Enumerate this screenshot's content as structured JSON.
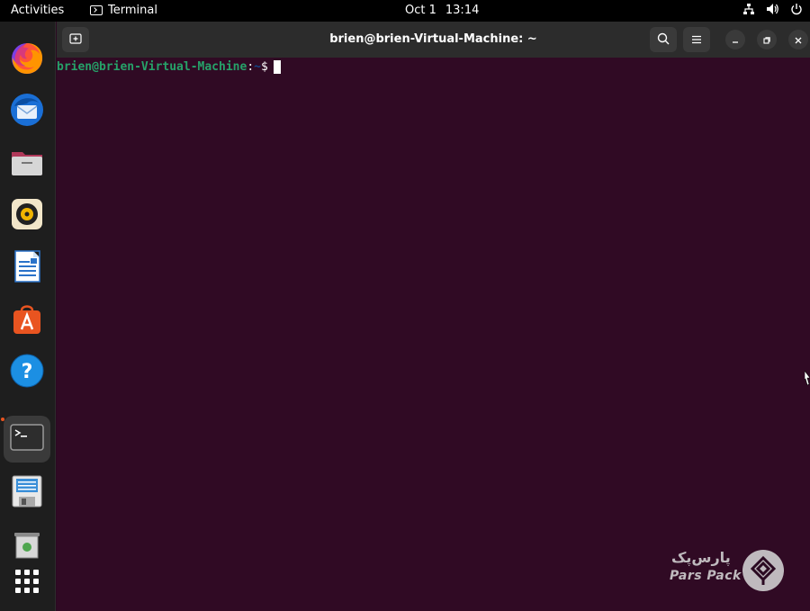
{
  "topbar": {
    "activities_label": "Activities",
    "app_name": "Terminal",
    "date": "Oct 1",
    "time": "13:14"
  },
  "dock": {
    "items": [
      {
        "name": "firefox",
        "icon": "firefox-icon"
      },
      {
        "name": "thunderbird",
        "icon": "thunderbird-icon"
      },
      {
        "name": "files",
        "icon": "files-icon"
      },
      {
        "name": "rhythmbox",
        "icon": "rhythmbox-icon"
      },
      {
        "name": "libreoffice-writer",
        "icon": "writer-icon"
      },
      {
        "name": "app-center",
        "icon": "app-center-icon"
      },
      {
        "name": "help",
        "icon": "help-icon"
      },
      {
        "name": "terminal",
        "icon": "terminal-icon",
        "active": true
      },
      {
        "name": "save",
        "icon": "floppy-icon"
      },
      {
        "name": "trash",
        "icon": "trash-icon"
      },
      {
        "name": "show-apps",
        "icon": "grid-icon"
      }
    ]
  },
  "window": {
    "title": "brien@brien-Virtual-Machine: ~",
    "prompt_user_host": "brien@brien-Virtual-Machine",
    "prompt_sep": ":",
    "prompt_path": "~",
    "prompt_symbol": "$"
  },
  "watermark": {
    "fa_text": "پارس‌پک",
    "en_text": "Pars Pack"
  },
  "colors": {
    "terminal_bg": "#300a24",
    "prompt_green": "#26a269",
    "prompt_blue": "#12488b",
    "accent": "#e95420"
  }
}
